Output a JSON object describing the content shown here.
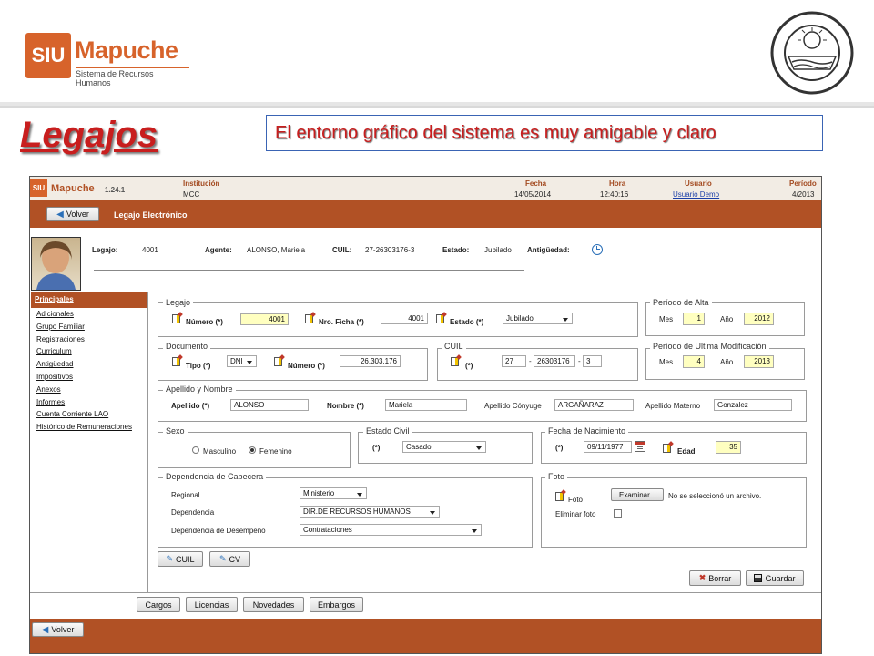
{
  "slide": {
    "title": "Legajos",
    "subtitle": "El entorno gráfico del sistema es muy amigable y claro",
    "logo": {
      "siu": "SIU",
      "name": "Mapuche",
      "tagline": "Sistema de Recursos Humanos"
    },
    "seal_icon": "university-seal"
  },
  "app": {
    "header": {
      "logo_siu": "SIU",
      "logo_name": "Mapuche",
      "version": "1.24.1",
      "institucion_label": "Institución",
      "institucion": "MCC",
      "fecha_label": "Fecha",
      "fecha": "14/05/2014",
      "hora_label": "Hora",
      "hora": "12:40:16",
      "usuario_label": "Usuario",
      "usuario": "Usuario Demo",
      "periodo_label": "Período",
      "periodo": "4/2013"
    },
    "toolbar": {
      "back": "Volver",
      "title": "Legajo Electrónico"
    },
    "person": {
      "legajo_label": "Legajo:",
      "legajo": "4001",
      "agente_label": "Agente:",
      "agente": "ALONSO, Mariela",
      "cuil_label": "CUIL:",
      "cuil": "27-26303176-3",
      "estado_label": "Estado:",
      "estado": "Jubilado",
      "antiguedad_label": "Antigüedad:"
    },
    "sidebar": {
      "header": "Principales",
      "items": [
        "Adicionales",
        "Grupo Familiar",
        "Registraciones",
        "Curriculum",
        "Antigüedad",
        "Impositivos",
        "Anexos",
        "Informes",
        "Cuenta Corriente LAO",
        "Histórico de Remuneraciones"
      ]
    },
    "form": {
      "legajo": {
        "legend": "Legajo",
        "numero_label": "Número (*)",
        "numero": "4001",
        "ficha_label": "Nro. Ficha (*)",
        "ficha": "4001",
        "estado_label": "Estado (*)",
        "estado": "Jubilado"
      },
      "alta": {
        "legend": "Período de Alta",
        "mes_label": "Mes",
        "mes": "1",
        "anio_label": "Año",
        "anio": "2012"
      },
      "documento": {
        "legend": "Documento",
        "tipo_label": "Tipo (*)",
        "tipo": "DNI",
        "numero_label": "Número (*)",
        "numero": "26.303.176"
      },
      "cuil": {
        "legend": "CUIL",
        "label": "(*)",
        "p1": "27",
        "sep1": "-",
        "p2": "26303176",
        "sep2": "-",
        "p3": "3"
      },
      "modif": {
        "legend": "Período de Ultima Modificación",
        "mes_label": "Mes",
        "mes": "4",
        "anio_label": "Año",
        "anio": "2013"
      },
      "nombre": {
        "legend": "Apellido y Nombre",
        "apellido_label": "Apellido (*)",
        "apellido": "ALONSO",
        "nombre_label": "Nombre (*)",
        "nombre": "Mariela",
        "conyuge_label": "Apellido Cónyuge",
        "conyuge": "ARGAÑARAZ",
        "materno_label": "Apellido Materno",
        "materno": "Gonzalez"
      },
      "sexo": {
        "legend": "Sexo",
        "masculino": "Masculino",
        "femenino": "Femenino",
        "selected": "Femenino"
      },
      "civil": {
        "legend": "Estado Civil",
        "label": "(*)",
        "value": "Casado"
      },
      "nacimiento": {
        "legend": "Fecha de Nacimiento",
        "label": "(*)",
        "fecha": "09/11/1977",
        "edad_label": "Edad",
        "edad": "35"
      },
      "dependencia": {
        "legend": "Dependencia de Cabecera",
        "regional_label": "Regional",
        "regional": "Ministerio",
        "dep_label": "Dependencia",
        "dep": "DIR.DE RECURSOS HUMANOS",
        "desemp_label": "Dependencia de Desempeño",
        "desemp": "Contrataciones"
      },
      "foto": {
        "legend": "Foto",
        "foto_label": "Foto",
        "examinar": "Examinar...",
        "no_file": "No se seleccionó un archivo.",
        "eliminar_label": "Eliminar foto"
      },
      "btn_cuil": "CUIL",
      "btn_cv": "CV",
      "borrar": "Borrar",
      "guardar": "Guardar"
    },
    "bottom_buttons": [
      "Cargos",
      "Licencias",
      "Novedades",
      "Embargos"
    ],
    "footer_back": "Volver"
  }
}
